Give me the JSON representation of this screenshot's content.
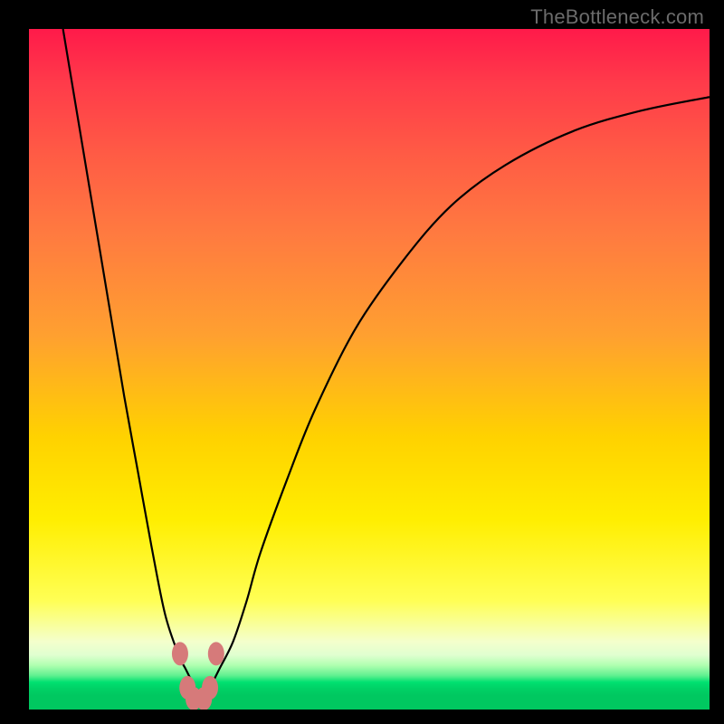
{
  "attribution": "TheBottleneck.com",
  "chart_data": {
    "type": "line",
    "title": "",
    "xlabel": "",
    "ylabel": "",
    "xlim": [
      0,
      100
    ],
    "ylim": [
      0,
      100
    ],
    "gradient_stops": [
      {
        "pos": 0,
        "color": "#ff1a4a"
      },
      {
        "pos": 8,
        "color": "#ff3b4a"
      },
      {
        "pos": 18,
        "color": "#ff5a45"
      },
      {
        "pos": 30,
        "color": "#ff7a40"
      },
      {
        "pos": 45,
        "color": "#ffa030"
      },
      {
        "pos": 60,
        "color": "#ffd200"
      },
      {
        "pos": 72,
        "color": "#ffee00"
      },
      {
        "pos": 84,
        "color": "#ffff55"
      },
      {
        "pos": 90,
        "color": "#f4ffcc"
      },
      {
        "pos": 93.5,
        "color": "#b0ffb0"
      },
      {
        "pos": 96,
        "color": "#00e070"
      },
      {
        "pos": 100,
        "color": "#00c860"
      }
    ],
    "series": [
      {
        "name": "bottleneck-curve",
        "x": [
          5,
          8,
          10,
          12,
          14,
          16,
          18,
          20,
          22,
          23,
          24,
          25,
          26,
          27,
          28,
          30,
          32,
          34,
          38,
          42,
          48,
          55,
          62,
          70,
          80,
          90,
          100
        ],
        "y": [
          100,
          82,
          70,
          58,
          46,
          35,
          24,
          14,
          8,
          6,
          4,
          2,
          2,
          4,
          6,
          10,
          16,
          23,
          34,
          44,
          56,
          66,
          74,
          80,
          85,
          88,
          90
        ]
      }
    ],
    "markers": {
      "name": "result-markers",
      "color": "#d67a7a",
      "points": [
        {
          "x": 22.2,
          "y": 8.2
        },
        {
          "x": 27.5,
          "y": 8.2
        },
        {
          "x": 23.3,
          "y": 3.2
        },
        {
          "x": 26.6,
          "y": 3.2
        },
        {
          "x": 24.2,
          "y": 1.6
        },
        {
          "x": 25.7,
          "y": 1.6
        }
      ]
    }
  }
}
